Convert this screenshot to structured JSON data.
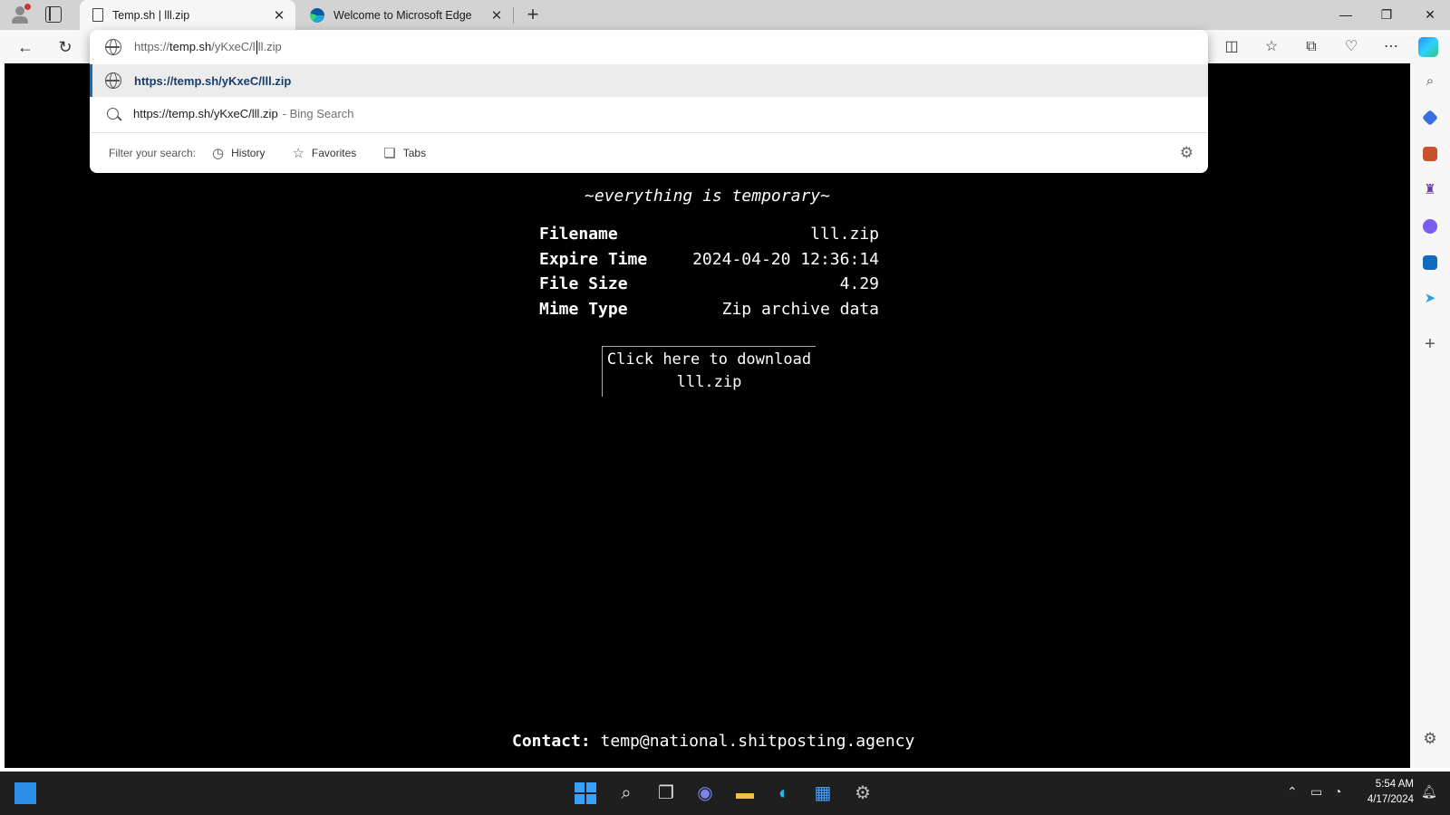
{
  "browser": {
    "tabs": [
      {
        "title": "Temp.sh | lll.zip",
        "active": true,
        "icon": "page-icon"
      },
      {
        "title": "Welcome to Microsoft Edge",
        "active": false,
        "icon": "edge-icon"
      }
    ],
    "new_tab_label": "+",
    "window_controls": {
      "minimize": "—",
      "restore": "❐",
      "close": "✕"
    }
  },
  "address_bar": {
    "typed_prefix": "https://",
    "typed_host": "temp.sh",
    "typed_path_a": "/yKxeC/l",
    "typed_path_b": "ll.zip"
  },
  "suggestions": {
    "top_url": "https://temp.sh/yKxeC/lll.zip",
    "search_query": "https://temp.sh/yKxeC/lll.zip",
    "search_engine": "- Bing Search",
    "filter_label": "Filter your search:",
    "filters": [
      "History",
      "Favorites",
      "Tabs"
    ]
  },
  "page": {
    "tagline": "~everything is temporary~",
    "file_info": [
      {
        "key": "Filename",
        "value": "lll.zip"
      },
      {
        "key": "Expire Time",
        "value": "2024-04-20 12:36:14"
      },
      {
        "key": "File Size",
        "value": "4.29"
      },
      {
        "key": "Mime Type",
        "value": "Zip archive data"
      }
    ],
    "download_line1": "Click here to download",
    "download_line2": "lll.zip",
    "contact_label": "Contact:",
    "contact_email": "temp@national.shitposting.agency"
  },
  "taskbar": {
    "time": "5:54 AM",
    "date": "4/17/2024"
  },
  "colors": {
    "page_background": "#000000",
    "accent": "#0f6cbd",
    "taskbar": "#1f1f1f"
  }
}
